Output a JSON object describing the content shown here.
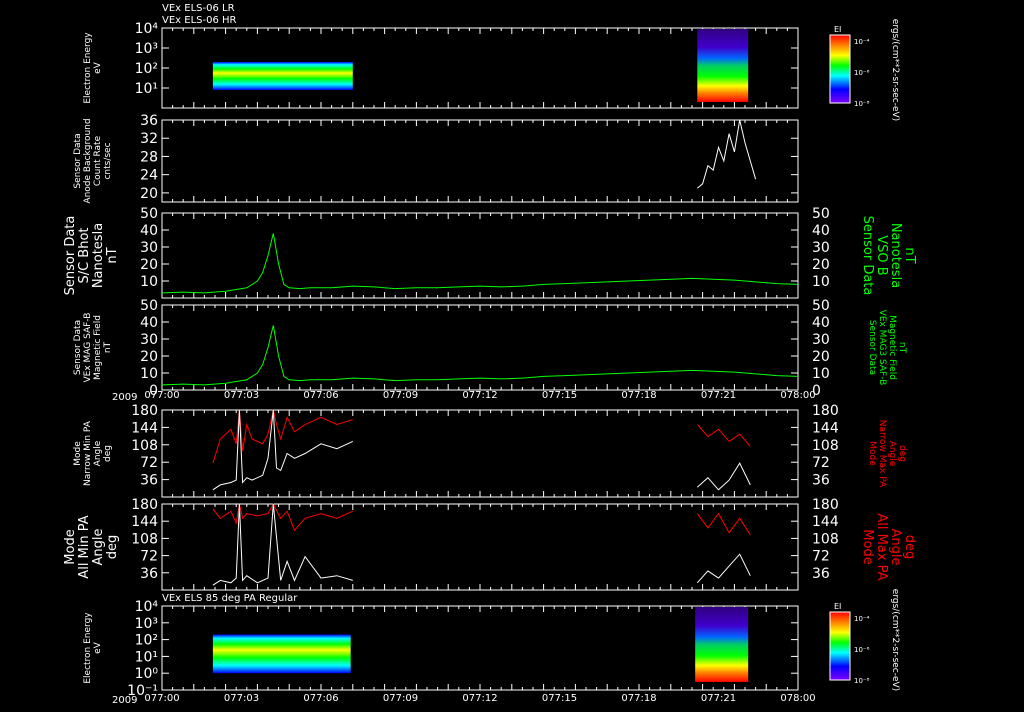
{
  "header": {
    "line1": "VEx ELS-06 LR",
    "line2": "VEx ELS-06 HR"
  },
  "colors": {
    "background": "#000000",
    "axis": "#ffffff",
    "green": "#00ff00",
    "red": "#ff0000",
    "white": "#ffffff"
  },
  "time_axis": {
    "year": "2009",
    "ticks": [
      "077:00",
      "077:03",
      "077:06",
      "077:09",
      "077:12",
      "077:15",
      "077:18",
      "077:21",
      "078:00"
    ],
    "range_minutes": [
      0,
      60
    ]
  },
  "chart_data": [
    {
      "id": "p1",
      "type": "heatmap",
      "ylabel_lines": [
        "Electron Energy",
        "eV"
      ],
      "yticks": [
        "10⁴",
        "10³",
        "10²",
        "10¹"
      ],
      "ylog": true,
      "ylim": [
        1,
        10000
      ],
      "blocks": [
        {
          "t_start": 4.8,
          "t_end": 18.0,
          "e_min": 8,
          "e_max": 200
        },
        {
          "t_start": 50.5,
          "t_end": 55.3,
          "e_min": 2,
          "e_max": 20000
        }
      ],
      "colorbar": {
        "title": "EI",
        "labels": [
          "10⁻⁴",
          "10⁻⁶",
          "10⁻⁸"
        ],
        "unit": "ergs/(cm**2-sr-sec-eV)"
      }
    },
    {
      "id": "p2",
      "type": "line",
      "ylabel_lines": [
        "Sensor Data",
        "Anode Background",
        "Count Rate",
        "cnts/sec"
      ],
      "yticks": [
        "36",
        "32",
        "28",
        "24",
        "20"
      ],
      "ylim": [
        18,
        36
      ],
      "series": [
        {
          "color": "white",
          "x": [
            50.5,
            51.0,
            51.5,
            52.0,
            52.5,
            53.0,
            53.5,
            54.0,
            54.5,
            55.0,
            55.5,
            56.0
          ],
          "y": [
            21,
            22,
            26,
            25,
            30,
            27,
            33,
            29,
            36,
            31,
            27,
            23
          ]
        }
      ]
    },
    {
      "id": "p3",
      "type": "line",
      "ylabel_lines": [
        "Sensor Data",
        "S/C Bhot",
        "Nanotesla",
        "nT"
      ],
      "rlabel_lines": [
        "Sensor Data",
        "VSO B",
        "Nanotesla",
        "nT"
      ],
      "yticks": [
        "50",
        "40",
        "30",
        "20",
        "10"
      ],
      "ylim": [
        0,
        50
      ],
      "series": [
        {
          "color": "green",
          "x": [
            0,
            2,
            4,
            6,
            8,
            9,
            9.5,
            10,
            10.5,
            11,
            11.5,
            12,
            13,
            14,
            16,
            18,
            20,
            22,
            24,
            26,
            28,
            30,
            32,
            34,
            36,
            38,
            40,
            42,
            44,
            46,
            48,
            50,
            52,
            54,
            56,
            58,
            60
          ],
          "y": [
            3,
            3.5,
            3,
            4,
            6,
            10,
            15,
            25,
            38,
            20,
            8,
            6,
            5.5,
            6,
            6,
            7,
            6.5,
            5.5,
            6,
            6,
            6.5,
            7,
            6.5,
            7,
            8,
            8.5,
            9,
            9.5,
            10,
            10.5,
            11,
            11.5,
            11,
            10.5,
            9.5,
            8.5,
            8
          ]
        }
      ]
    },
    {
      "id": "p4",
      "type": "line",
      "ylabel_lines": [
        "Sensor Data",
        "VEx MAG SAF-B",
        "Magnetic Field",
        "nT"
      ],
      "rlabel_lines": [
        "Sensor Data",
        "VEx MAG3 SAF-B",
        "Magnetic Field",
        "nT"
      ],
      "yticks": [
        "50",
        "40",
        "30",
        "20",
        "10",
        "0"
      ],
      "ylim": [
        0,
        50
      ],
      "series": [
        {
          "color": "green",
          "x": [
            0,
            2,
            4,
            6,
            8,
            9,
            9.5,
            10,
            10.5,
            11,
            11.5,
            12,
            13,
            14,
            16,
            18,
            20,
            22,
            24,
            26,
            28,
            30,
            32,
            34,
            36,
            38,
            40,
            42,
            44,
            46,
            48,
            50,
            52,
            54,
            56,
            58,
            60
          ],
          "y": [
            3,
            3.5,
            3,
            4,
            6,
            10,
            15,
            25,
            38,
            20,
            8,
            6,
            5.5,
            6,
            6,
            7,
            6.5,
            5.5,
            6,
            6,
            6.5,
            7,
            6.5,
            7,
            8,
            8.5,
            9,
            9.5,
            10,
            10.5,
            11,
            11.5,
            11,
            10.5,
            9.5,
            8.5,
            8
          ]
        }
      ]
    },
    {
      "id": "p5",
      "type": "line",
      "ylabel_lines": [
        "Mode",
        "Narrow Min PA",
        "Angle",
        "deg"
      ],
      "rlabel_lines": [
        "Mode",
        "Narrow Max PA",
        "Angle",
        "deg"
      ],
      "yticks": [
        "180",
        "144",
        "108",
        "72",
        "36"
      ],
      "ylim": [
        0,
        180
      ],
      "series": [
        {
          "color": "red",
          "x": [
            4.8,
            5.5,
            6.5,
            7.0,
            7.3,
            7.6,
            8.0,
            8.5,
            9.5,
            10.0,
            10.5,
            10.8,
            11.2,
            11.8,
            12.5,
            13.5,
            15.0,
            16.5,
            18.0
          ],
          "y": [
            70,
            120,
            140,
            110,
            180,
            95,
            150,
            120,
            110,
            130,
            180,
            150,
            120,
            165,
            135,
            150,
            165,
            150,
            160
          ]
        },
        {
          "color": "white",
          "x": [
            4.8,
            5.5,
            6.5,
            7.0,
            7.3,
            7.6,
            8.0,
            8.5,
            9.5,
            10.0,
            10.5,
            10.8,
            11.2,
            11.8,
            12.5,
            13.5,
            15.0,
            16.5,
            18.0
          ],
          "y": [
            15,
            25,
            30,
            35,
            180,
            30,
            40,
            35,
            45,
            80,
            180,
            60,
            55,
            90,
            80,
            90,
            110,
            100,
            115
          ]
        },
        {
          "color": "red",
          "x": [
            50.5,
            51.5,
            52.5,
            53.5,
            54.5,
            55.5
          ],
          "y": [
            150,
            125,
            140,
            115,
            130,
            105
          ]
        },
        {
          "color": "white",
          "x": [
            50.5,
            51.5,
            52.5,
            53.5,
            54.5,
            55.5
          ],
          "y": [
            20,
            40,
            15,
            35,
            70,
            25
          ]
        }
      ]
    },
    {
      "id": "p6",
      "type": "line",
      "ylabel_lines": [
        "Mode",
        "All Min PA",
        "Angle",
        "deg"
      ],
      "rlabel_lines": [
        "Mode",
        "All Max PA",
        "Angle",
        "deg"
      ],
      "yticks": [
        "180",
        "144",
        "108",
        "72",
        "36"
      ],
      "ylim": [
        0,
        180
      ],
      "series": [
        {
          "color": "red",
          "x": [
            4.8,
            5.5,
            6.5,
            7.0,
            7.3,
            7.6,
            8.0,
            9.0,
            10.0,
            10.5,
            11.2,
            11.8,
            12.5,
            13.5,
            15.0,
            16.5,
            18.0
          ],
          "y": [
            170,
            150,
            165,
            140,
            180,
            150,
            160,
            155,
            160,
            180,
            150,
            165,
            125,
            150,
            160,
            150,
            165
          ]
        },
        {
          "color": "white",
          "x": [
            4.8,
            5.5,
            6.5,
            7.0,
            7.3,
            7.6,
            8.0,
            9.0,
            10.0,
            10.5,
            11.2,
            11.8,
            12.5,
            13.5,
            15.0,
            16.5,
            18.0
          ],
          "y": [
            10,
            20,
            15,
            25,
            180,
            20,
            30,
            15,
            25,
            180,
            20,
            60,
            20,
            70,
            25,
            30,
            20
          ]
        },
        {
          "color": "red",
          "x": [
            50.5,
            51.5,
            52.5,
            53.5,
            54.5,
            55.5
          ],
          "y": [
            160,
            130,
            160,
            120,
            150,
            115
          ]
        },
        {
          "color": "white",
          "x": [
            50.5,
            51.5,
            52.5,
            53.5,
            54.5,
            55.5
          ],
          "y": [
            15,
            40,
            25,
            50,
            75,
            30
          ]
        }
      ]
    },
    {
      "id": "p7",
      "type": "heatmap",
      "title": "VEx ELS 85 deg PA Regular",
      "ylabel_lines": [
        "Electron Energy",
        "eV"
      ],
      "yticks": [
        "10⁴",
        "10³",
        "10²",
        "10¹",
        "10⁰",
        "10⁻¹"
      ],
      "ylog": true,
      "ylim": [
        0.1,
        10000
      ],
      "blocks": [
        {
          "t_start": 4.8,
          "t_end": 17.8,
          "e_min": 1,
          "e_max": 200
        },
        {
          "t_start": 50.3,
          "t_end": 55.3,
          "e_min": 0.3,
          "e_max": 20000
        }
      ],
      "colorbar": {
        "title": "EI",
        "labels": [
          "10⁻⁴",
          "10⁻⁶",
          "10⁻⁸"
        ],
        "unit": "ergs/(cm**2-sr-sec-eV)"
      }
    }
  ]
}
